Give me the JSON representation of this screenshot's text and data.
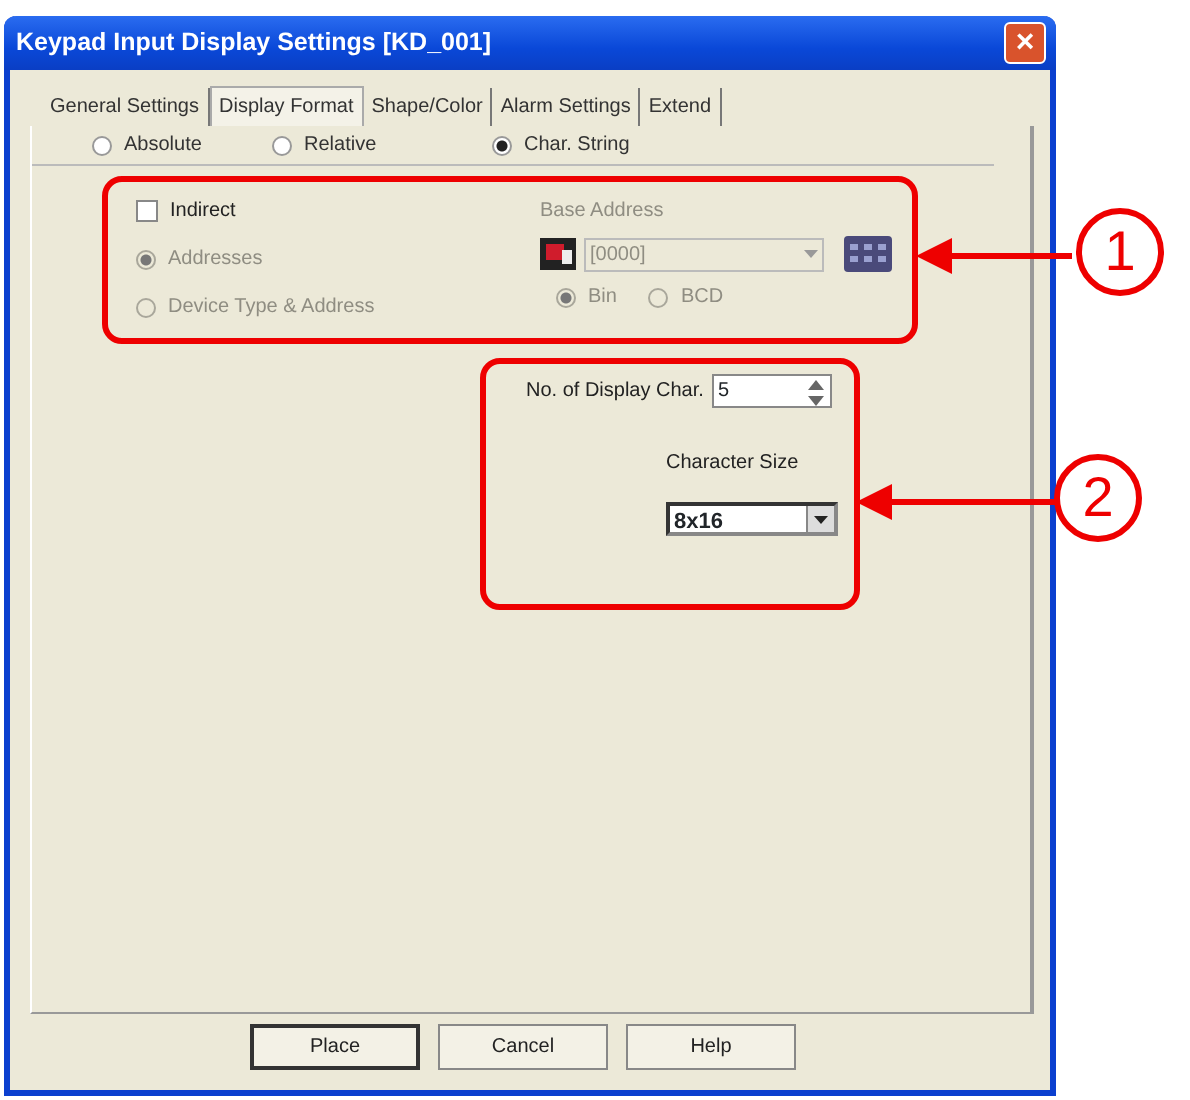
{
  "window": {
    "title": "Keypad Input Display Settings [KD_001]",
    "close": "×"
  },
  "tabs": [
    {
      "label": "General Settings",
      "selected": false
    },
    {
      "label": "Display Format",
      "selected": true
    },
    {
      "label": "Shape/Color",
      "selected": false
    },
    {
      "label": "Alarm Settings",
      "selected": false
    },
    {
      "label": "Extend",
      "selected": false
    }
  ],
  "format_options": [
    {
      "label": "Absolute",
      "selected": false
    },
    {
      "label": "Relative",
      "selected": false
    },
    {
      "label": "Char. String",
      "selected": true
    }
  ],
  "indirect": {
    "label": "Indirect",
    "checked": false
  },
  "address_options": [
    {
      "label": "Addresses",
      "selected": true,
      "disabled": true
    },
    {
      "label": "Device Type & Address",
      "selected": false,
      "disabled": true
    }
  ],
  "base_address": {
    "label": "Base Address",
    "value": "[0000]",
    "disabled": true
  },
  "code_options": [
    {
      "label": "Bin",
      "selected": true,
      "disabled": true
    },
    {
      "label": "BCD",
      "selected": false,
      "disabled": true
    }
  ],
  "display_chars": {
    "label": "No. of Display Char.",
    "value": "5"
  },
  "character_size": {
    "label": "Character Size",
    "value": "8x16"
  },
  "buttons": [
    {
      "label": "Place",
      "default": true
    },
    {
      "label": "Cancel",
      "default": false
    },
    {
      "label": "Help",
      "default": false
    }
  ],
  "callouts": [
    {
      "label": "1"
    },
    {
      "label": "2"
    }
  ]
}
